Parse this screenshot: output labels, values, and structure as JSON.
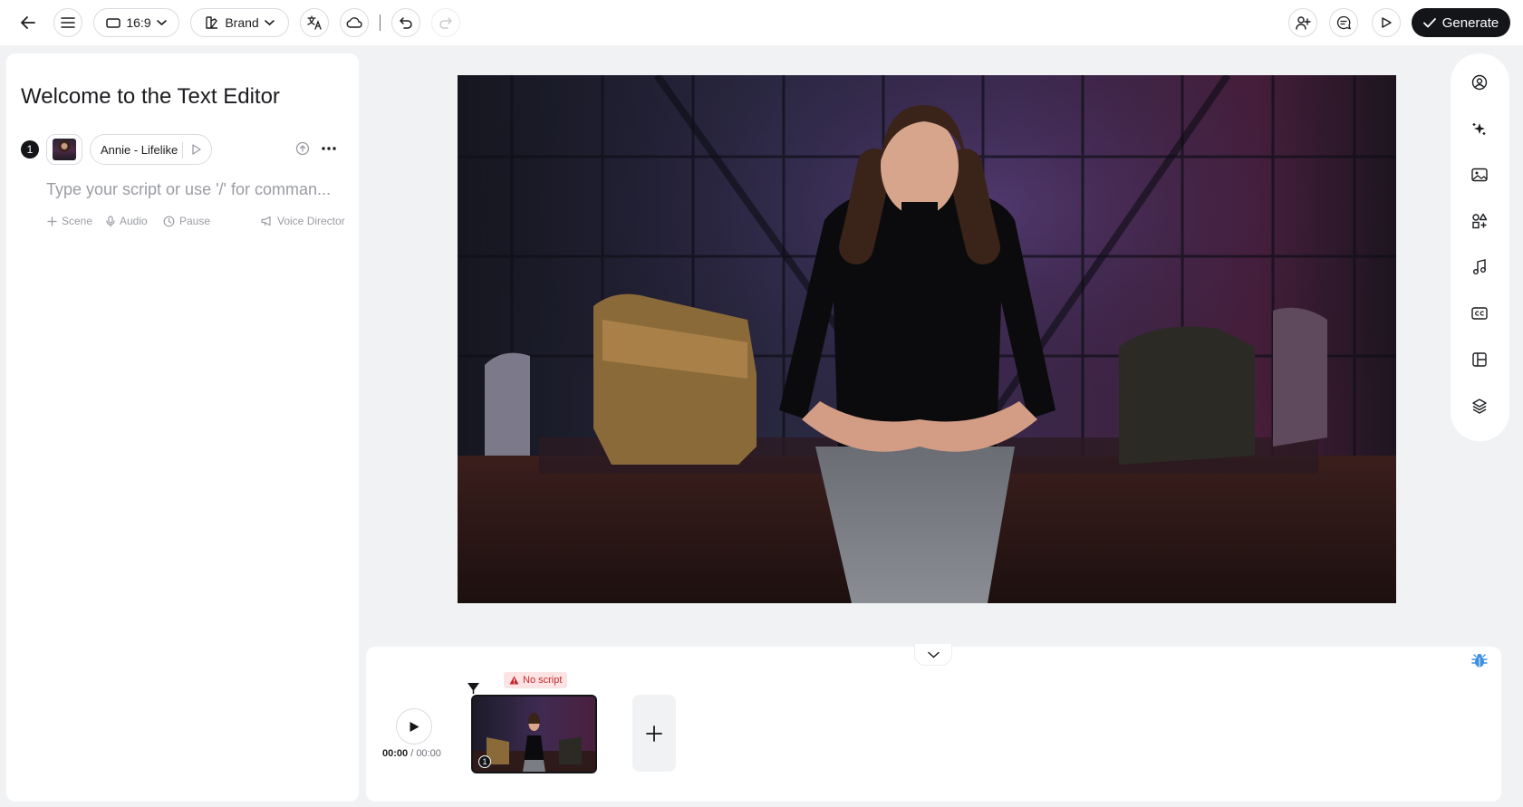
{
  "topbar": {
    "aspect_label": "16:9",
    "brand_label": "Brand",
    "generate_label": "Generate"
  },
  "editor": {
    "title": "Welcome to the Text Editor",
    "scene_number": "1",
    "voice_name": "Annie - Lifelike",
    "script_placeholder": "Type your script or use '/' for comman...",
    "tools": {
      "scene": "Scene",
      "audio": "Audio",
      "pause": "Pause",
      "voice_director": "Voice Director"
    }
  },
  "timeline": {
    "current_time": "00:00",
    "separator": " / ",
    "total_time": "00:00",
    "warning": "No script",
    "scene_badge": "1"
  },
  "colors": {
    "accent_dark": "#141519",
    "panel": "#ffffff",
    "background": "#f1f2f4",
    "warning_bg": "#fde4e4",
    "warning_text": "#c2282b",
    "bug_icon": "#3b8fe0"
  },
  "icons": [
    "back-arrow-icon",
    "menu-icon",
    "aspect-ratio-icon",
    "chevron-down-icon",
    "brand-icon",
    "translate-icon",
    "cloud-icon",
    "undo-icon",
    "redo-icon",
    "add-user-icon",
    "comment-icon",
    "preview-play-icon",
    "check-icon",
    "avatar-icon",
    "sparkle-icon",
    "image-icon",
    "elements-icon",
    "music-icon",
    "captions-icon",
    "layout-icon",
    "layers-icon",
    "bug-icon"
  ]
}
